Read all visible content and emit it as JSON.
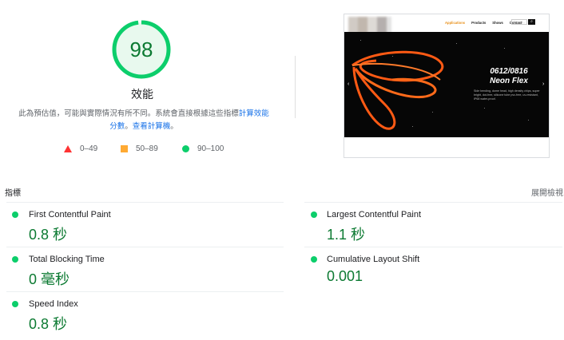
{
  "performance": {
    "score": 98,
    "score_fraction": 0.98,
    "title": "效能",
    "description_prefix": "此為預估值，可能與實際情況有所不同。系統會直接根據這些指標",
    "link_calc": "計算效能分數",
    "description_sep": "。",
    "link_calculator": "查看計算機",
    "description_suffix": "。",
    "colors": {
      "pass": "#0cce6b",
      "average": "#ffaa33",
      "fail": "#ff3333"
    }
  },
  "legend": {
    "fail": "0–49",
    "average": "50–89",
    "pass": "90–100"
  },
  "screenshot": {
    "nav": [
      "Applications",
      "Products",
      "Shows",
      "Contact"
    ],
    "search_placeholder": "Search...",
    "hero_title_line1": "0612/0816",
    "hero_title_line2": "Neon Flex",
    "hero_text": "Side bending, dome head, high density chips, super bright, dot-free, silicone tube pvc-free, uv-resistant, IP68 water-proof."
  },
  "metrics": {
    "label": "指標",
    "expand": "展開檢視",
    "items": [
      {
        "name": "First Contentful Paint",
        "value": "0.8 秒"
      },
      {
        "name": "Largest Contentful Paint",
        "value": "1.1 秒"
      },
      {
        "name": "Total Blocking Time",
        "value": "0 毫秒"
      },
      {
        "name": "Cumulative Layout Shift",
        "value": "0.001"
      },
      {
        "name": "Speed Index",
        "value": "0.8 秒"
      }
    ]
  }
}
